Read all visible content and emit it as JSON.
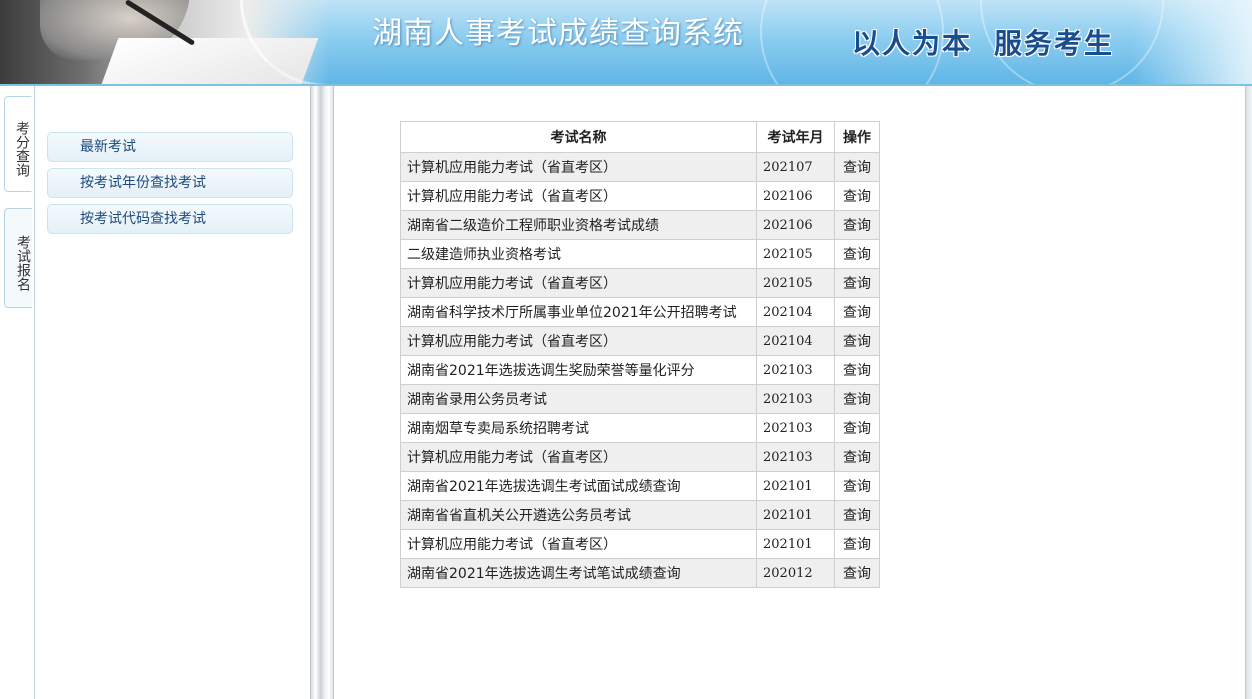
{
  "header": {
    "title": "湖南人事考试成绩查询系统",
    "slogan_part1": "以人为本",
    "slogan_part2": "服务考生"
  },
  "tabs": [
    {
      "label": "考分查询",
      "active": true
    },
    {
      "label": "考试报名",
      "active": false
    }
  ],
  "side_menu": [
    {
      "label": "最新考试"
    },
    {
      "label": "按考试年份查找考试"
    },
    {
      "label": "按考试代码查找考试"
    }
  ],
  "table": {
    "headers": [
      "考试名称",
      "考试年月",
      "操作"
    ],
    "rows": [
      {
        "name": "计算机应用能力考试（省直考区）",
        "month": "202107",
        "action": "查询"
      },
      {
        "name": "计算机应用能力考试（省直考区）",
        "month": "202106",
        "action": "查询"
      },
      {
        "name": "湖南省二级造价工程师职业资格考试成绩",
        "month": "202106",
        "action": "查询"
      },
      {
        "name": "二级建造师执业资格考试",
        "month": "202105",
        "action": "查询"
      },
      {
        "name": "计算机应用能力考试（省直考区）",
        "month": "202105",
        "action": "查询"
      },
      {
        "name": "湖南省科学技术厅所属事业单位2021年公开招聘考试",
        "month": "202104",
        "action": "查询"
      },
      {
        "name": "计算机应用能力考试（省直考区）",
        "month": "202104",
        "action": "查询"
      },
      {
        "name": "湖南省2021年选拔选调生奖励荣誉等量化评分",
        "month": "202103",
        "action": "查询"
      },
      {
        "name": "湖南省录用公务员考试",
        "month": "202103",
        "action": "查询"
      },
      {
        "name": "湖南烟草专卖局系统招聘考试",
        "month": "202103",
        "action": "查询"
      },
      {
        "name": "计算机应用能力考试（省直考区）",
        "month": "202103",
        "action": "查询"
      },
      {
        "name": "湖南省2021年选拔选调生考试面试成绩查询",
        "month": "202101",
        "action": "查询"
      },
      {
        "name": "湖南省省直机关公开遴选公务员考试",
        "month": "202101",
        "action": "查询"
      },
      {
        "name": "计算机应用能力考试（省直考区）",
        "month": "202101",
        "action": "查询"
      },
      {
        "name": "湖南省2021年选拔选调生考试笔试成绩查询",
        "month": "202012",
        "action": "查询"
      }
    ]
  }
}
